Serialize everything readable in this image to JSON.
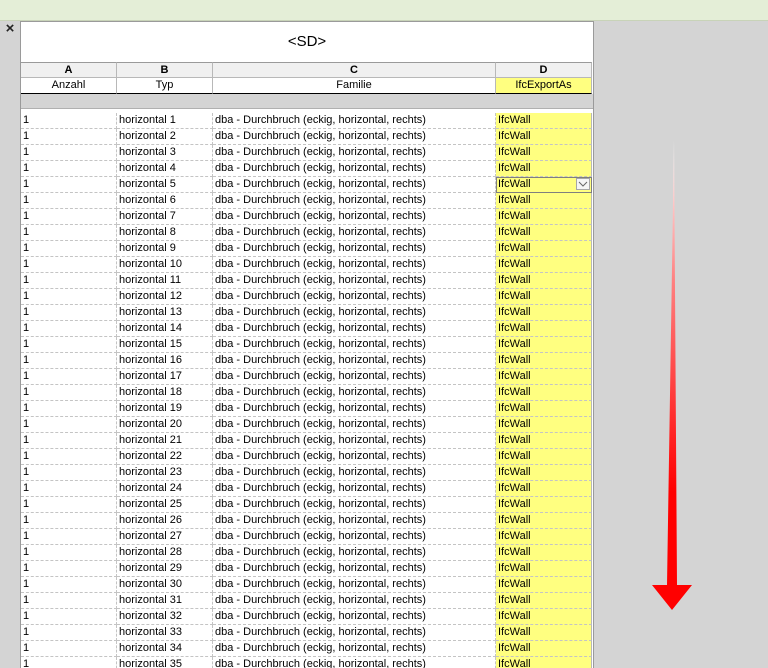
{
  "close_label": "×",
  "schedule": {
    "title": "<SD>",
    "column_letters": [
      "A",
      "B",
      "C",
      "D"
    ],
    "column_headers": [
      "Anzahl",
      "Typ",
      "Familie",
      "IfcExportAs"
    ],
    "rows": [
      [
        "1",
        "horizontal 1",
        "dba - Durchbruch (eckig, horizontal, rechts)",
        "IfcWall"
      ],
      [
        "1",
        "horizontal 2",
        "dba - Durchbruch (eckig, horizontal, rechts)",
        "IfcWall"
      ],
      [
        "1",
        "horizontal 3",
        "dba - Durchbruch (eckig, horizontal, rechts)",
        "IfcWall"
      ],
      [
        "1",
        "horizontal 4",
        "dba - Durchbruch (eckig, horizontal, rechts)",
        "IfcWall"
      ],
      [
        "1",
        "horizontal 5",
        "dba - Durchbruch (eckig, horizontal, rechts)",
        "IfcWall"
      ],
      [
        "1",
        "horizontal 6",
        "dba - Durchbruch (eckig, horizontal, rechts)",
        "IfcWall"
      ],
      [
        "1",
        "horizontal 7",
        "dba - Durchbruch (eckig, horizontal, rechts)",
        "IfcWall"
      ],
      [
        "1",
        "horizontal 8",
        "dba - Durchbruch (eckig, horizontal, rechts)",
        "IfcWall"
      ],
      [
        "1",
        "horizontal 9",
        "dba - Durchbruch (eckig, horizontal, rechts)",
        "IfcWall"
      ],
      [
        "1",
        "horizontal 10",
        "dba - Durchbruch (eckig, horizontal, rechts)",
        "IfcWall"
      ],
      [
        "1",
        "horizontal 11",
        "dba - Durchbruch (eckig, horizontal, rechts)",
        "IfcWall"
      ],
      [
        "1",
        "horizontal 12",
        "dba - Durchbruch (eckig, horizontal, rechts)",
        "IfcWall"
      ],
      [
        "1",
        "horizontal 13",
        "dba - Durchbruch (eckig, horizontal, rechts)",
        "IfcWall"
      ],
      [
        "1",
        "horizontal 14",
        "dba - Durchbruch (eckig, horizontal, rechts)",
        "IfcWall"
      ],
      [
        "1",
        "horizontal 15",
        "dba - Durchbruch (eckig, horizontal, rechts)",
        "IfcWall"
      ],
      [
        "1",
        "horizontal 16",
        "dba - Durchbruch (eckig, horizontal, rechts)",
        "IfcWall"
      ],
      [
        "1",
        "horizontal 17",
        "dba - Durchbruch (eckig, horizontal, rechts)",
        "IfcWall"
      ],
      [
        "1",
        "horizontal 18",
        "dba - Durchbruch (eckig, horizontal, rechts)",
        "IfcWall"
      ],
      [
        "1",
        "horizontal 19",
        "dba - Durchbruch (eckig, horizontal, rechts)",
        "IfcWall"
      ],
      [
        "1",
        "horizontal 20",
        "dba - Durchbruch (eckig, horizontal, rechts)",
        "IfcWall"
      ],
      [
        "1",
        "horizontal 21",
        "dba - Durchbruch (eckig, horizontal, rechts)",
        "IfcWall"
      ],
      [
        "1",
        "horizontal 22",
        "dba - Durchbruch (eckig, horizontal, rechts)",
        "IfcWall"
      ],
      [
        "1",
        "horizontal 23",
        "dba - Durchbruch (eckig, horizontal, rechts)",
        "IfcWall"
      ],
      [
        "1",
        "horizontal 24",
        "dba - Durchbruch (eckig, horizontal, rechts)",
        "IfcWall"
      ],
      [
        "1",
        "horizontal 25",
        "dba - Durchbruch (eckig, horizontal, rechts)",
        "IfcWall"
      ],
      [
        "1",
        "horizontal 26",
        "dba - Durchbruch (eckig, horizontal, rechts)",
        "IfcWall"
      ],
      [
        "1",
        "horizontal 27",
        "dba - Durchbruch (eckig, horizontal, rechts)",
        "IfcWall"
      ],
      [
        "1",
        "horizontal 28",
        "dba - Durchbruch (eckig, horizontal, rechts)",
        "IfcWall"
      ],
      [
        "1",
        "horizontal 29",
        "dba - Durchbruch (eckig, horizontal, rechts)",
        "IfcWall"
      ],
      [
        "1",
        "horizontal 30",
        "dba - Durchbruch (eckig, horizontal, rechts)",
        "IfcWall"
      ],
      [
        "1",
        "horizontal 31",
        "dba - Durchbruch (eckig, horizontal, rechts)",
        "IfcWall"
      ],
      [
        "1",
        "horizontal 32",
        "dba - Durchbruch (eckig, horizontal, rechts)",
        "IfcWall"
      ],
      [
        "1",
        "horizontal 33",
        "dba - Durchbruch (eckig, horizontal, rechts)",
        "IfcWall"
      ],
      [
        "1",
        "horizontal 34",
        "dba - Durchbruch (eckig, horizontal, rechts)",
        "IfcWall"
      ],
      [
        "1",
        "horizontal 35",
        "dba - Durchbruch (eckig, horizontal, rechts)",
        "IfcWall"
      ]
    ],
    "selected_row_index": 4,
    "highlight_color": "#ffff80"
  },
  "annotation": {
    "icon": "down-arrow-icon",
    "color": "#ff0000"
  }
}
